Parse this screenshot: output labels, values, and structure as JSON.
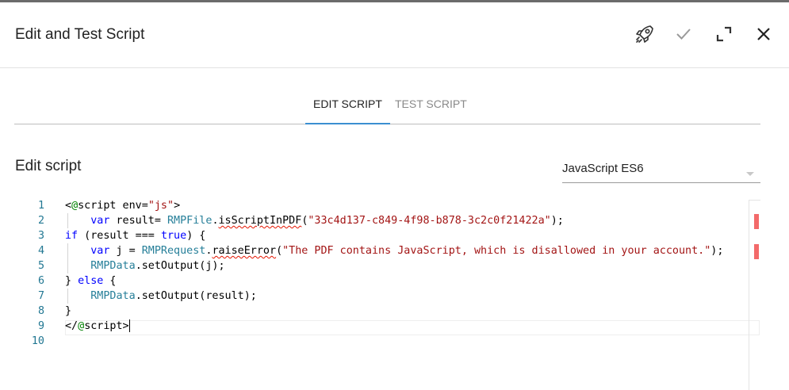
{
  "header": {
    "title": "Edit and Test Script",
    "actions": [
      {
        "name": "launch",
        "icon": "rocket-icon"
      },
      {
        "name": "confirm",
        "icon": "check-icon"
      },
      {
        "name": "maximize",
        "icon": "expand-icon"
      },
      {
        "name": "close",
        "icon": "close-icon"
      }
    ]
  },
  "tabs": [
    {
      "label": "EDIT SCRIPT",
      "active": true
    },
    {
      "label": "TEST SCRIPT",
      "active": false
    }
  ],
  "section": {
    "title": "Edit script"
  },
  "language_select": {
    "value": "JavaScript ES6"
  },
  "editor": {
    "line_numbers": [
      "1",
      "2",
      "3",
      "4",
      "5",
      "6",
      "7",
      "8",
      "9",
      "10"
    ],
    "cursor_line": 9,
    "lines": [
      [
        {
          "t": "<",
          "c": "def"
        },
        {
          "t": "@",
          "c": "dec"
        },
        {
          "t": "script env=",
          "c": "def"
        },
        {
          "t": "\"js\"",
          "c": "str"
        },
        {
          "t": ">",
          "c": "def"
        }
      ],
      [
        {
          "t": "    ",
          "c": "def"
        },
        {
          "t": "var",
          "c": "kw"
        },
        {
          "t": " result= ",
          "c": "def"
        },
        {
          "t": "RMPFile",
          "c": "id"
        },
        {
          "t": ".",
          "c": "def"
        },
        {
          "t": "isScriptInPDF",
          "c": "def",
          "err": true
        },
        {
          "t": "(",
          "c": "def"
        },
        {
          "t": "\"33c4d137-c849-4f98-b878-3c2c0f21422a\"",
          "c": "str"
        },
        {
          "t": ");",
          "c": "def"
        }
      ],
      [
        {
          "t": "if",
          "c": "kw"
        },
        {
          "t": " (result === ",
          "c": "def"
        },
        {
          "t": "true",
          "c": "kw"
        },
        {
          "t": ") {",
          "c": "def"
        }
      ],
      [
        {
          "t": "    ",
          "c": "def"
        },
        {
          "t": "var",
          "c": "kw"
        },
        {
          "t": " j = ",
          "c": "def"
        },
        {
          "t": "RMPRequest",
          "c": "id"
        },
        {
          "t": ".",
          "c": "def"
        },
        {
          "t": "raiseError",
          "c": "def",
          "err": true
        },
        {
          "t": "(",
          "c": "def"
        },
        {
          "t": "\"The PDF contains JavaScript, which is disallowed in your account.\"",
          "c": "str"
        },
        {
          "t": ");",
          "c": "def"
        }
      ],
      [
        {
          "t": "    ",
          "c": "def"
        },
        {
          "t": "RMPData",
          "c": "id"
        },
        {
          "t": ".setOutput(j);",
          "c": "def"
        }
      ],
      [
        {
          "t": "} ",
          "c": "def"
        },
        {
          "t": "else",
          "c": "kw"
        },
        {
          "t": " {",
          "c": "def"
        }
      ],
      [
        {
          "t": "    ",
          "c": "def"
        },
        {
          "t": "RMPData",
          "c": "id"
        },
        {
          "t": ".setOutput(result);",
          "c": "def"
        }
      ],
      [
        {
          "t": "}",
          "c": "def"
        }
      ],
      [
        {
          "t": "</",
          "c": "def"
        },
        {
          "t": "@",
          "c": "dec"
        },
        {
          "t": "script>",
          "c": "def"
        }
      ],
      []
    ],
    "error_marks": [
      2,
      4
    ],
    "colors": {
      "keyword": "#0000ff",
      "string": "#a31515",
      "identifier": "#267f99",
      "error": "#f36a6a",
      "line_number": "#237893"
    }
  },
  "accent_color": "#3b8fd1"
}
